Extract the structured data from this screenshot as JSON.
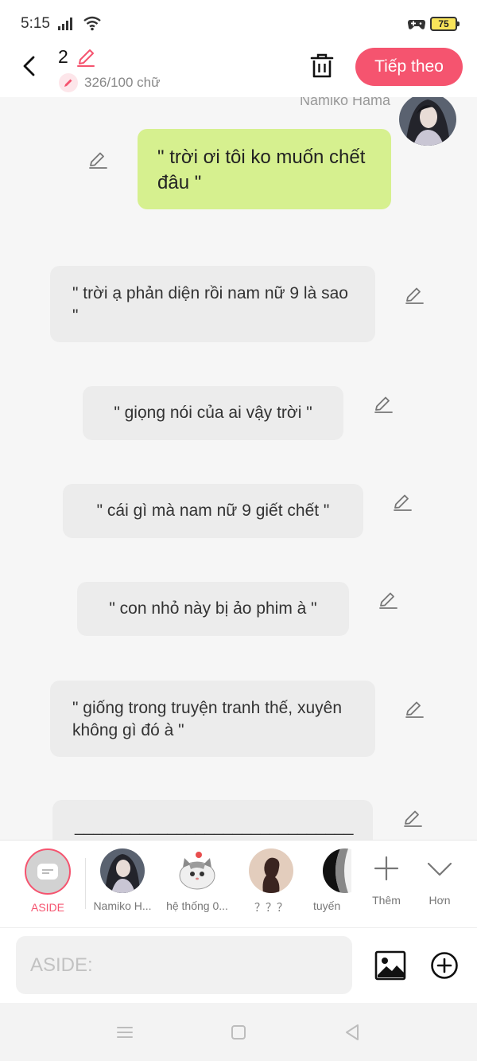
{
  "status_bar": {
    "time": "5:15",
    "battery": "75"
  },
  "header": {
    "page_count": "2",
    "word_count": "326/100 chữ",
    "next_label": "Tiếp theo"
  },
  "chat": {
    "sender_name": "Namiko Hama",
    "user_message": "\" trời ơi tôi ko muốn chết đâu \"",
    "aside_messages": [
      "\" trời ạ phản diện rồi nam nữ 9 là sao \"",
      "\" giọng nói của ai vậy trời \"",
      "\" cái gì mà nam nữ 9 giết chết \"",
      "\" con nhỏ này bị ảo phim à \"",
      "\" giống trong truyện tranh thế, xuyên không gì đó à \"",
      "______________________________"
    ]
  },
  "characters": [
    {
      "label": "ASIDE",
      "selected": true
    },
    {
      "label": "Namiko H..."
    },
    {
      "label": "hệ thống 0..."
    },
    {
      "label": "？？？"
    },
    {
      "label": "tuyến"
    }
  ],
  "tools": {
    "more_label": "Thêm",
    "expand_label": "Hơn"
  },
  "input": {
    "placeholder": "ASIDE:"
  },
  "colors": {
    "accent": "#f5546f",
    "user_bubble": "#d6f08f",
    "aside_bubble": "#ececec",
    "background": "#f6f6f6"
  }
}
